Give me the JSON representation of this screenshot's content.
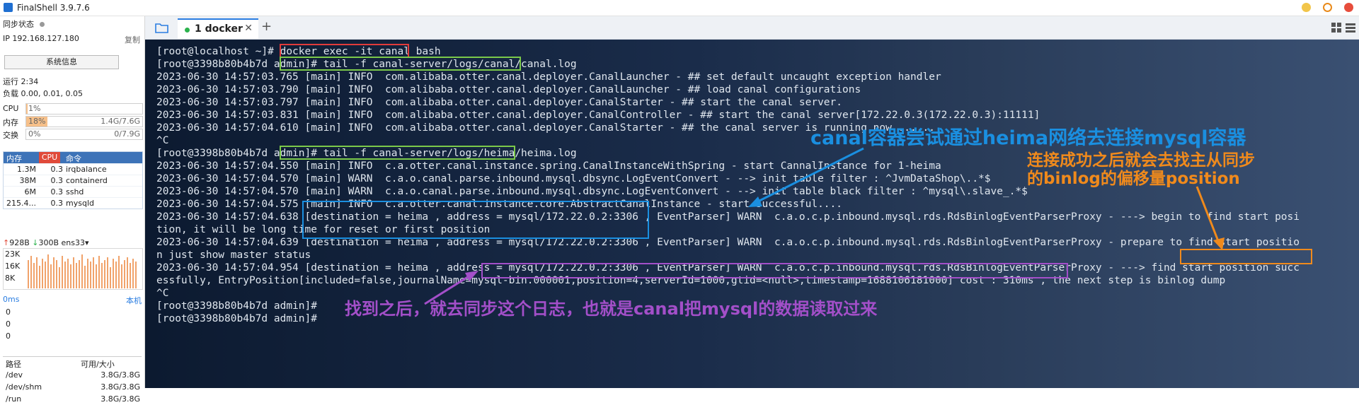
{
  "window": {
    "title": "FinalShell 3.9.7.6"
  },
  "sidebar": {
    "sync_label": "同步状态",
    "ip": "IP 192.168.127.180",
    "copy_label": "复制",
    "sysinfo_button": "系统信息",
    "uptime": "运行 2:34",
    "load": "负载 0.00, 0.01, 0.05",
    "cpu": {
      "label": "CPU",
      "value": "1%",
      "fraction": 0.01
    },
    "mem": {
      "label": "内存",
      "value": "18%",
      "detail": "1.4G/7.6G",
      "fraction": 0.18
    },
    "swap": {
      "label": "交换",
      "value": "0%",
      "detail": "0/7.9G",
      "fraction": 0.0
    },
    "proc_headers": [
      "内存",
      "CPU",
      "命令"
    ],
    "processes": [
      {
        "mem": "1.3M",
        "cpu": "0.3",
        "cmd": "irqbalance"
      },
      {
        "mem": "38M",
        "cpu": "0.3",
        "cmd": "containerd"
      },
      {
        "mem": "6M",
        "cpu": "0.3",
        "cmd": "sshd"
      },
      {
        "mem": "215.4...",
        "cpu": "0.3",
        "cmd": "mysqld"
      }
    ],
    "net": {
      "up": "928B",
      "down": "300B",
      "iface": "ens33"
    },
    "net_ticks": [
      "23K",
      "16K",
      "8K"
    ],
    "ping": {
      "label": "0ms",
      "host": "本机",
      "ticks": [
        "0",
        "0",
        "0"
      ]
    },
    "disk_headers": [
      "路径",
      "可用/大小"
    ],
    "disks": [
      {
        "path": "/dev",
        "size": "3.8G/3.8G"
      },
      {
        "path": "/dev/shm",
        "size": "3.8G/3.8G"
      },
      {
        "path": "/run",
        "size": "3.8G/3.8G"
      }
    ]
  },
  "tabs": [
    {
      "label": "1 docker"
    }
  ],
  "terminal": {
    "lines": [
      "[root@localhost ~]# docker exec -it canal bash",
      "[root@3398b80b4b7d admin]# tail -f canal-server/logs/canal/canal.log",
      "2023-06-30 14:57:03.765 [main] INFO  com.alibaba.otter.canal.deployer.CanalLauncher - ## set default uncaught exception handler",
      "2023-06-30 14:57:03.790 [main] INFO  com.alibaba.otter.canal.deployer.CanalLauncher - ## load canal configurations",
      "2023-06-30 14:57:03.797 [main] INFO  com.alibaba.otter.canal.deployer.CanalStarter - ## start the canal server.",
      "2023-06-30 14:57:03.831 [main] INFO  com.alibaba.otter.canal.deployer.CanalController - ## start the canal server[172.22.0.3(172.22.0.3):11111]",
      "2023-06-30 14:57:04.610 [main] INFO  com.alibaba.otter.canal.deployer.CanalStarter - ## the canal server is running now ......",
      "^C",
      "[root@3398b80b4b7d admin]# tail -f canal-server/logs/heima/heima.log",
      "2023-06-30 14:57:04.550 [main] INFO  c.a.otter.canal.instance.spring.CanalInstanceWithSpring - start CannalInstance for 1-heima",
      "2023-06-30 14:57:04.570 [main] WARN  c.a.o.canal.parse.inbound.mysql.dbsync.LogEventConvert - --> init table filter : ^JvmDataShop\\..*$",
      "2023-06-30 14:57:04.570 [main] WARN  c.a.o.canal.parse.inbound.mysql.dbsync.LogEventConvert - --> init table black filter : ^mysql\\.slave_.*$",
      "2023-06-30 14:57:04.575 [main] INFO  c.a.otter.canal.instance.core.AbstractCanalInstance - start successful....",
      "2023-06-30 14:57:04.638 [destination = heima , address = mysql/172.22.0.2:3306 , EventParser] WARN  c.a.o.c.p.inbound.mysql.rds.RdsBinlogEventParserProxy - ---> begin to find start posi",
      "tion, it will be long time for reset or first position",
      "2023-06-30 14:57:04.639 [destination = heima , address = mysql/172.22.0.2:3306 , EventParser] WARN  c.a.o.c.p.inbound.mysql.rds.RdsBinlogEventParserProxy - prepare to find start positio",
      "n just show master status",
      "2023-06-30 14:57:04.954 [destination = heima , address = mysql/172.22.0.2:3306 , EventParser] WARN  c.a.o.c.p.inbound.mysql.rds.RdsBinlogEventParserProxy - ---> find start position succ",
      "essfully, EntryPosition[included=false,journalName=mysql-bin.000001,position=4,serverId=1000,gtid=<null>,timestamp=1688106181000] cost : 310ms , the next step is binlog dump",
      "^C",
      "[root@3398b80b4b7d admin]#",
      "[root@3398b80b4b7d admin]#"
    ]
  },
  "annotations": {
    "note1": "canal容器尝试通过heima网络去连接mysql容器",
    "note2_line1": "连接成功之后就会去找主从同步",
    "note2_line2": "的binlog的偏移量position",
    "note3": "找到之后，就去同步这个日志，也就是canal把mysql的数据读取过来"
  },
  "colors": {
    "red_box": "#e23b3b",
    "green_box": "#7bc94a",
    "blue": "#1a8fe0",
    "orange": "#f08a1c",
    "purple": "#a34fc9"
  }
}
